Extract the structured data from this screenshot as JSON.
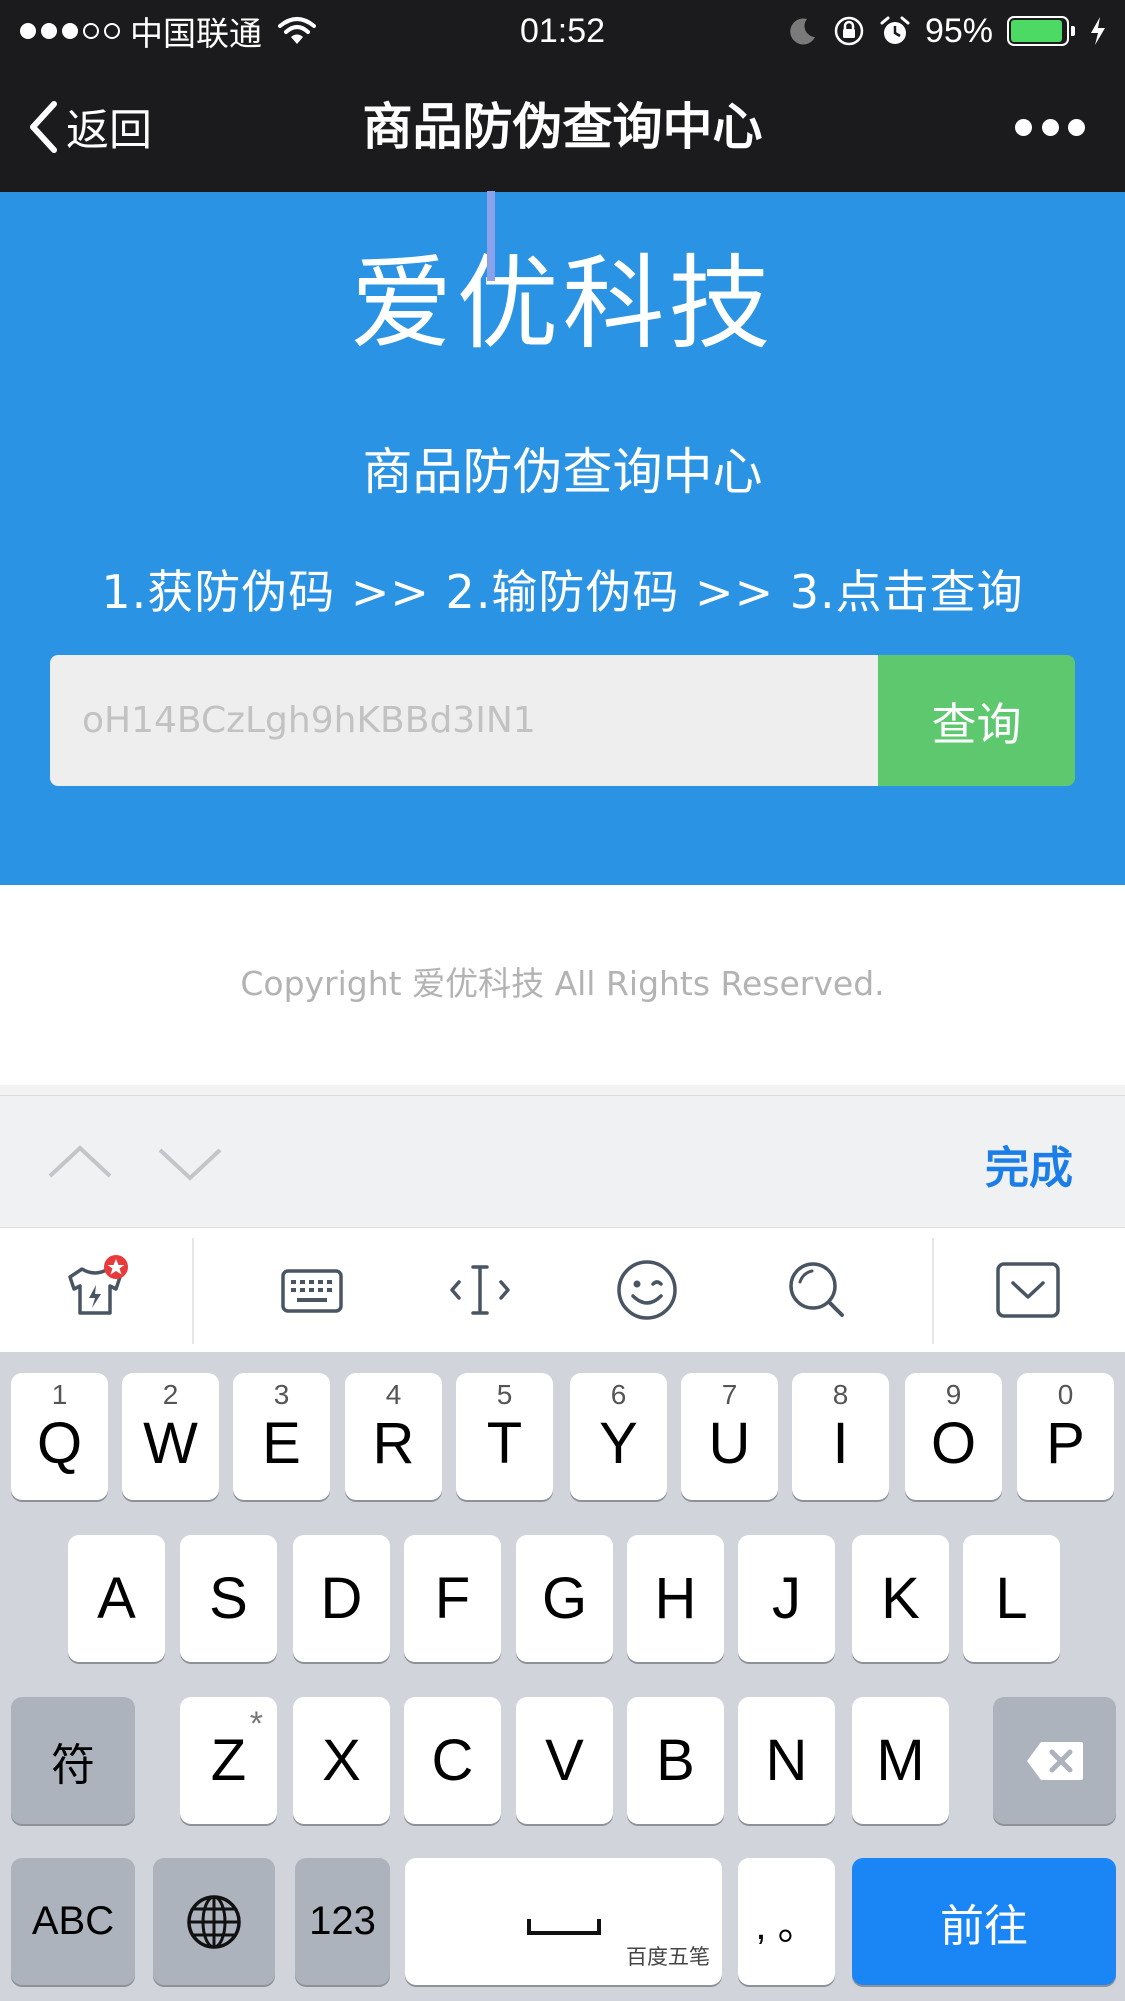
{
  "status": {
    "carrier": "中国联通",
    "time": "01:52",
    "battery_pct": "95%",
    "battery_level": 0.95,
    "signal_bars": 3,
    "signal_total": 5
  },
  "nav": {
    "back_label": "返回",
    "title": "商品防伪查询中心"
  },
  "hero": {
    "brand": "爱优科技",
    "subtitle": "商品防伪查询中心",
    "steps": "1.获防伪码 >> 2.输防伪码 >> 3.点击查询",
    "input_placeholder": "oH14BCzLgh9hKBBd3IN1",
    "query_label": "查询"
  },
  "footer": {
    "copyright": "Copyright 爱优科技 All Rights Reserved."
  },
  "accessory": {
    "done_label": "完成"
  },
  "keyboard": {
    "row1": [
      {
        "letter": "Q",
        "num": "1"
      },
      {
        "letter": "W",
        "num": "2"
      },
      {
        "letter": "E",
        "num": "3"
      },
      {
        "letter": "R",
        "num": "4"
      },
      {
        "letter": "T",
        "num": "5"
      },
      {
        "letter": "Y",
        "num": "6"
      },
      {
        "letter": "U",
        "num": "7"
      },
      {
        "letter": "I",
        "num": "8"
      },
      {
        "letter": "O",
        "num": "9"
      },
      {
        "letter": "P",
        "num": "0"
      }
    ],
    "row2": [
      "A",
      "S",
      "D",
      "F",
      "G",
      "H",
      "J",
      "K",
      "L"
    ],
    "row3": [
      "Z",
      "X",
      "C",
      "V",
      "B",
      "N",
      "M"
    ],
    "z_mark": "*",
    "symbol_key": "符",
    "abc_key": "ABC",
    "num_key": "123",
    "space_hint": "百度五笔",
    "punct_key": ", 。",
    "go_key": "前往"
  },
  "colors": {
    "hero_bg": "#2b93e3",
    "query_btn": "#5dc86e",
    "go_key": "#1a86f5",
    "done": "#1a7de8"
  }
}
